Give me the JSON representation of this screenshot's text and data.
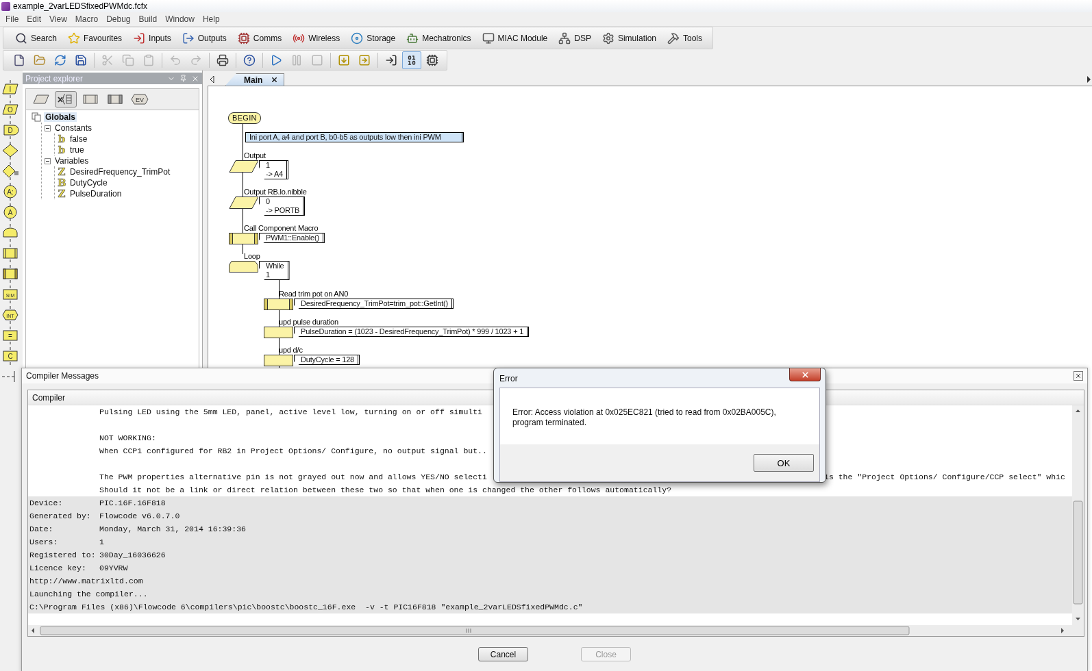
{
  "window": {
    "title": "example_2varLEDSfixedPWMdc.fcfx"
  },
  "menu": [
    "File",
    "Edit",
    "View",
    "Macro",
    "Debug",
    "Build",
    "Window",
    "Help"
  ],
  "component_toolbar": [
    {
      "kind": "search",
      "label": "Search"
    },
    {
      "kind": "favourites",
      "label": "Favourites"
    },
    {
      "kind": "inputs",
      "label": "Inputs"
    },
    {
      "kind": "outputs",
      "label": "Outputs"
    },
    {
      "kind": "comms",
      "label": "Comms"
    },
    {
      "kind": "wireless",
      "label": "Wireless"
    },
    {
      "kind": "storage",
      "label": "Storage"
    },
    {
      "kind": "mechatronics",
      "label": "Mechatronics"
    },
    {
      "kind": "miac",
      "label": "MIAC Module"
    },
    {
      "kind": "dsp",
      "label": "DSP"
    },
    {
      "kind": "simulation",
      "label": "Simulation"
    },
    {
      "kind": "tools",
      "label": "Tools"
    }
  ],
  "main_toolbar": [
    [
      {
        "kind": "new",
        "disabled": false,
        "selected": false
      },
      {
        "kind": "open",
        "disabled": false,
        "selected": false
      },
      {
        "kind": "reload",
        "disabled": false,
        "selected": false
      },
      {
        "kind": "save",
        "disabled": false,
        "selected": false
      }
    ],
    [
      {
        "kind": "cut",
        "disabled": true,
        "selected": false
      },
      {
        "kind": "copy",
        "disabled": true,
        "selected": false
      },
      {
        "kind": "paste",
        "disabled": true,
        "selected": false
      }
    ],
    [
      {
        "kind": "undo",
        "disabled": true,
        "selected": false
      },
      {
        "kind": "redo",
        "disabled": true,
        "selected": false
      }
    ],
    [
      {
        "kind": "print",
        "disabled": false,
        "selected": false
      }
    ],
    [
      {
        "kind": "help",
        "disabled": false,
        "selected": false
      }
    ],
    [
      {
        "kind": "run",
        "disabled": false,
        "selected": false
      },
      {
        "kind": "pause",
        "disabled": true,
        "selected": false
      },
      {
        "kind": "stop",
        "disabled": true,
        "selected": false
      }
    ],
    [
      {
        "kind": "step_into",
        "disabled": false,
        "selected": false
      },
      {
        "kind": "step_over",
        "disabled": false,
        "selected": false
      }
    ],
    [
      {
        "kind": "enter",
        "disabled": false,
        "selected": false
      },
      {
        "kind": "binary",
        "disabled": false,
        "selected": true
      },
      {
        "kind": "chip",
        "disabled": false,
        "selected": false
      }
    ]
  ],
  "palette": [
    {
      "kind": "input",
      "label": "I"
    },
    {
      "kind": "output",
      "label": "O"
    },
    {
      "kind": "delay",
      "label": "D"
    },
    {
      "kind": "decision"
    },
    {
      "kind": "switch"
    },
    {
      "kind": "connection_point",
      "label": "A:"
    },
    {
      "kind": "goto",
      "label": "A"
    },
    {
      "kind": "loop"
    },
    {
      "kind": "macro"
    },
    {
      "kind": "component_macro"
    },
    {
      "kind": "simulation",
      "label": "SIM"
    },
    {
      "kind": "interrupt",
      "label": "INT"
    },
    {
      "kind": "calculation",
      "label": "="
    },
    {
      "kind": "code",
      "label": "C"
    },
    {
      "kind": "comment"
    }
  ],
  "project_explorer": {
    "title": "Project explorer",
    "tabs": [
      {
        "kind": "io",
        "selected": false
      },
      {
        "kind": "variables",
        "selected": true
      },
      {
        "kind": "macro",
        "selected": false
      },
      {
        "kind": "component_macro",
        "selected": false
      },
      {
        "kind": "events",
        "label": "EV",
        "selected": false
      }
    ],
    "tree": [
      {
        "label": "Globals",
        "selected": true,
        "children": [
          {
            "label": "Constants",
            "selected": false,
            "expanded": true,
            "children": [
              {
                "label": "false",
                "type": "b",
                "selected": false
              },
              {
                "label": "true",
                "type": "b",
                "selected": false
              }
            ]
          },
          {
            "label": "Variables",
            "selected": false,
            "expanded": true,
            "children": [
              {
                "label": "DesiredFrequency_TrimPot",
                "type": "Z",
                "selected": false
              },
              {
                "label": "DutyCycle",
                "type": "B",
                "selected": false
              },
              {
                "label": "PulseDuration",
                "type": "Z",
                "selected": false
              }
            ]
          }
        ]
      }
    ]
  },
  "editor": {
    "tabs": [
      {
        "label": "Main",
        "selected": true
      }
    ],
    "flowchart": [
      {
        "kind": "begin",
        "label": "BEGIN"
      },
      {
        "kind": "comment",
        "text": "Ini port A, a4 and port B, b0-b5 as outputs low then ini PWM"
      },
      {
        "kind": "output",
        "title": "Output",
        "lines": [
          "1",
          "-> A4"
        ]
      },
      {
        "kind": "output",
        "title": "Output RB.lo.nibble",
        "lines": [
          "0",
          "-> PORTB"
        ]
      },
      {
        "kind": "component_macro",
        "title": "Call Component Macro",
        "lines": [
          "PWM1::Enable()"
        ]
      },
      {
        "kind": "loop",
        "title": "Loop",
        "lines": [
          "While",
          "1"
        ],
        "children": [
          {
            "kind": "component_macro",
            "title": "Read trim pot on AN0",
            "lines": [
              "DesiredFrequency_TrimPot=trim_pot::GetInt()"
            ]
          },
          {
            "kind": "calculation",
            "title": "upd pulse duration",
            "lines": [
              "PulseDuration = (1023 - DesiredFrequency_TrimPot) * 999 / 1023 + 1"
            ]
          },
          {
            "kind": "calculation",
            "title": "upd d/c",
            "lines": [
              "DutyCycle = 128"
            ]
          }
        ]
      }
    ]
  },
  "compiler_messages": {
    "title": "Compiler Messages",
    "tab": "Compiler",
    "paragraphs": [
      [
        {
          "text": "Pulsing LED using the 5mm LED, panel, active level low, turning on or off simulti"
        }
      ],
      [
        {
          "text": "NOT WORKING:"
        },
        {
          "text": "When CCP1 configured for RB2 in Project Options/ Configure, no output signal but.."
        }
      ],
      [
        {
          "text": "The PWM properties alternative pin is not grayed out now and allows YES/NO selecti",
          "text_after_dialog": "is the \"Project Options/ Configure/CCP select\" whic"
        },
        {
          "text": "Should it not be a link or direct relation between these two so that when one is changed the other follows automatically?"
        }
      ]
    ],
    "info": [
      {
        "kind": "field",
        "label": "Device:",
        "value": "PIC.16F.16F818"
      },
      {
        "kind": "field",
        "label": "Generated by:",
        "value": "Flowcode v6.0.7.0"
      },
      {
        "kind": "field",
        "label": "Date:",
        "value": "Monday, March 31, 2014 16:39:36"
      },
      {
        "kind": "field",
        "label": "Users:",
        "value": "1"
      },
      {
        "kind": "field",
        "label": "Registered to:",
        "value": "30Day_16036626"
      },
      {
        "kind": "field",
        "label": "Licence key:",
        "value": "09YVRW"
      },
      {
        "kind": "plain",
        "text": "http://www.matrixltd.com"
      },
      {
        "kind": "plain",
        "text": "Launching the compiler..."
      },
      {
        "kind": "plain",
        "text": "C:\\Program Files (x86)\\Flowcode 6\\compilers\\pic\\boostc\\boostc_16F.exe  -v -t PIC16F818 \"example_2varLEDSfixedPWMdc.c\""
      }
    ],
    "buttons": [
      {
        "label": "Cancel",
        "disabled": false
      },
      {
        "label": "Close",
        "disabled": true
      }
    ]
  },
  "error_dialog": {
    "title": "Error",
    "message": "Error: Access violation at 0x025EC821 (tried to read from 0x02BA005C), program terminated.",
    "button": "OK"
  }
}
